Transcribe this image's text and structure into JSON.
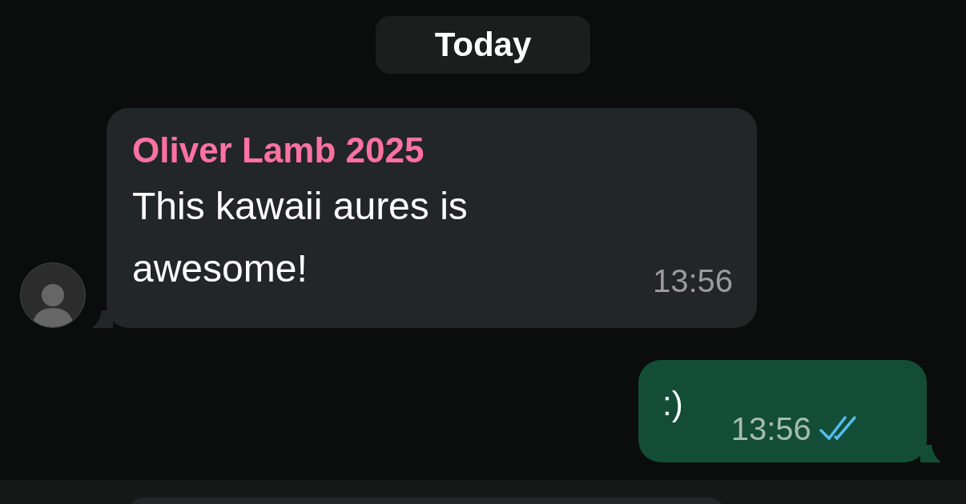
{
  "date_divider": "Today",
  "messages": [
    {
      "kind": "incoming",
      "sender": "Oliver Lamb 2025",
      "color": "#ff72a1",
      "text": "This kawaii aures is awesome!",
      "time": "13:56"
    },
    {
      "kind": "outgoing",
      "text": ":)",
      "time": "13:56",
      "read": true
    }
  ]
}
